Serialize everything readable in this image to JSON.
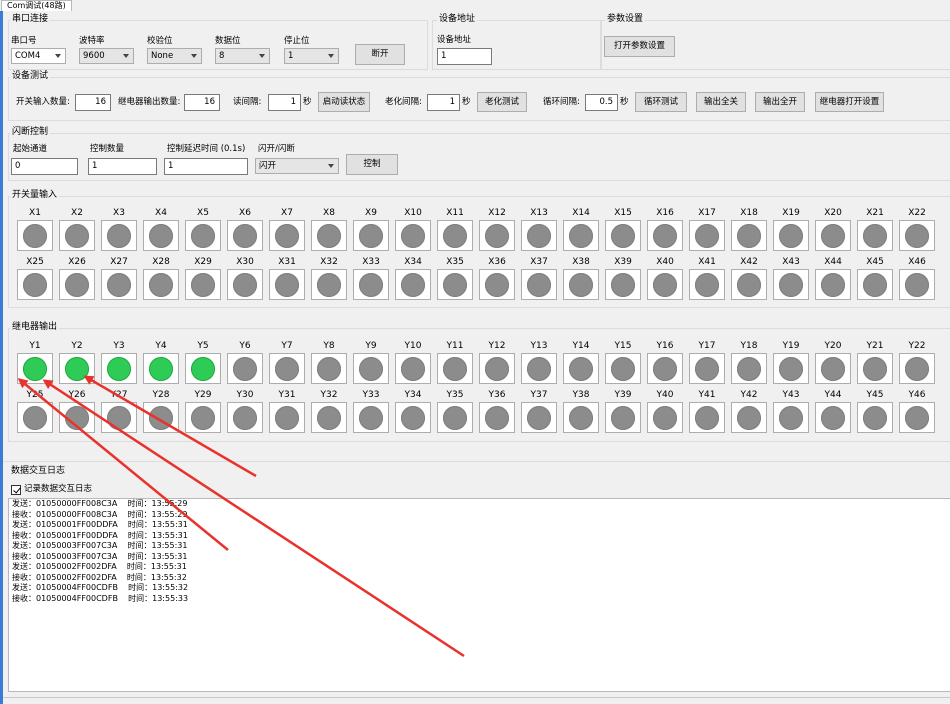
{
  "window": {
    "tab_title": "Com调试(48路)"
  },
  "serial": {
    "group_title": "串口连接",
    "port_label": "串口号",
    "port_value": "COM4",
    "baud_label": "波特率",
    "baud_value": "9600",
    "parity_label": "校验位",
    "parity_value": "None",
    "databits_label": "数据位",
    "databits_value": "8",
    "stopbits_label": "停止位",
    "stopbits_value": "1",
    "disconnect_label": "断开"
  },
  "device_address": {
    "group_title": "设备地址",
    "label": "设备地址",
    "value": "1"
  },
  "params": {
    "group_title": "参数设置",
    "open_button": "打开参数设置"
  },
  "device_test": {
    "group_title": "设备测试",
    "input_count_label": "开关输入数量:",
    "input_count": "16",
    "relay_count_label": "继电器输出数量:",
    "relay_count": "16",
    "read_interval_label": "读间隔:",
    "read_interval": "1",
    "read_unit": "秒",
    "start_read_button": "启动读状态",
    "aging_label": "老化间隔:",
    "aging_interval": "1",
    "aging_unit": "秒",
    "aging_button": "老化测试",
    "cycle_label": "循环间隔:",
    "cycle_interval": "0.5",
    "cycle_unit": "秒",
    "cycle_button": "循环测试",
    "all_off_button": "输出全关",
    "all_on_button": "输出全开",
    "relay_open_settings_button": "继电器打开设置"
  },
  "flash_control": {
    "group_title": "闪断控制",
    "start_channel_label": "起始通道",
    "start_channel": "0",
    "count_label": "控制数量",
    "count": "1",
    "delay_label": "控制延迟时间 (0.1s)",
    "delay": "1",
    "mode_label": "闪开/闪断",
    "mode_value": "闪开",
    "control_button": "控制"
  },
  "inputs": {
    "group_title": "开关量输入",
    "row1": [
      "X1",
      "X2",
      "X3",
      "X4",
      "X5",
      "X6",
      "X7",
      "X8",
      "X9",
      "X10",
      "X11",
      "X12",
      "X13",
      "X14",
      "X15",
      "X16",
      "X17",
      "X18",
      "X19",
      "X20",
      "X21",
      "X22"
    ],
    "row2": [
      "X25",
      "X26",
      "X27",
      "X28",
      "X29",
      "X30",
      "X31",
      "X32",
      "X33",
      "X34",
      "X35",
      "X36",
      "X37",
      "X38",
      "X39",
      "X40",
      "X41",
      "X42",
      "X43",
      "X44",
      "X45",
      "X46"
    ]
  },
  "relays": {
    "group_title": "继电器输出",
    "row1": [
      "Y1",
      "Y2",
      "Y3",
      "Y4",
      "Y5",
      "Y6",
      "Y7",
      "Y8",
      "Y9",
      "Y10",
      "Y11",
      "Y12",
      "Y13",
      "Y14",
      "Y15",
      "Y16",
      "Y17",
      "Y18",
      "Y19",
      "Y20",
      "Y21",
      "Y22"
    ],
    "row2": [
      "Y25",
      "Y26",
      "Y27",
      "Y28",
      "Y29",
      "Y30",
      "Y31",
      "Y32",
      "Y33",
      "Y34",
      "Y35",
      "Y36",
      "Y37",
      "Y38",
      "Y39",
      "Y40",
      "Y41",
      "Y42",
      "Y43",
      "Y44",
      "Y45",
      "Y46"
    ],
    "row1_on": [
      true,
      true,
      true,
      true,
      true,
      false,
      false,
      false,
      false,
      false,
      false,
      false,
      false,
      false,
      false,
      false,
      false,
      false,
      false,
      false,
      false,
      false
    ],
    "row2_on": [
      false,
      false,
      false,
      false,
      false,
      false,
      false,
      false,
      false,
      false,
      false,
      false,
      false,
      false,
      false,
      false,
      false,
      false,
      false,
      false,
      false,
      false
    ]
  },
  "log": {
    "group_title": "数据交互日志",
    "record_label": "记录数据交互日志",
    "record_checked": true,
    "lines": [
      "发送：01050000FF008C3A    时间：13:55:29",
      "接收：01050000FF008C3A    时间：13:55:29",
      "发送：01050001FF00DDFA    时间：13:55:31",
      "接收：01050001FF00DDFA    时间：13:55:31",
      "发送：01050003FF007C3A    时间：13:55:31",
      "接收：01050003FF007C3A    时间：13:55:31",
      "发送：01050002FF002DFA    时间：13:55:31",
      "接收：01050002FF002DFA    时间：13:55:32",
      "发送：01050004FF00CDFB    时间：13:55:32",
      "接收：01050004FF00CDFB    时间：13:55:33"
    ]
  },
  "colors": {
    "led_on": "#2ecc56",
    "led_off": "#8c8c8c",
    "annotation_arrow": "#e8322b"
  }
}
